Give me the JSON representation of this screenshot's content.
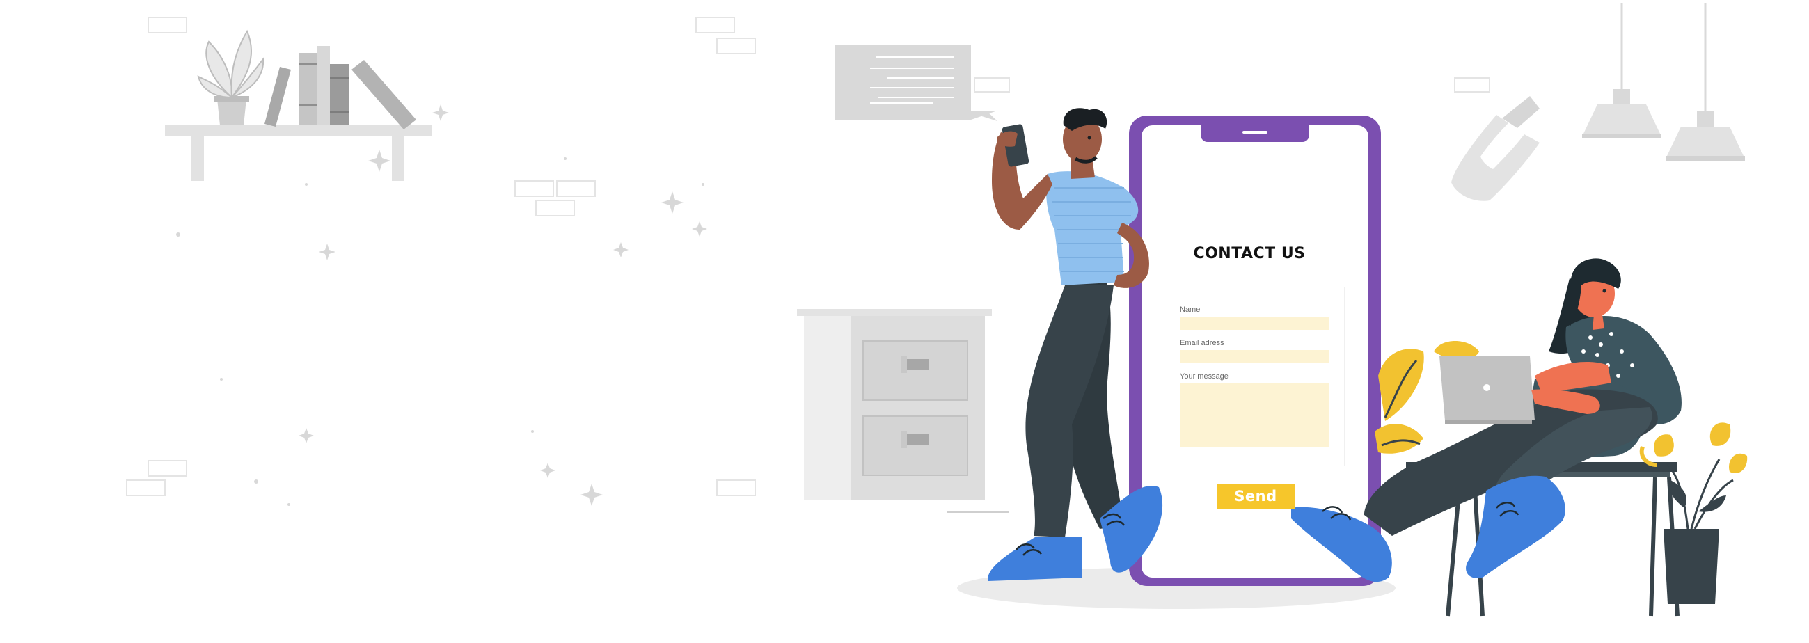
{
  "contact": {
    "title": "CONTACT US",
    "fields": {
      "name_label": "Name",
      "email_label": "Email adress",
      "message_label": "Your message"
    },
    "send_label": "Send"
  },
  "colors": {
    "phone_frame": "#7b4fb0",
    "send_button": "#f6c62b",
    "field_fill": "#fdf3d3",
    "shoe_blue": "#3f7fdc",
    "shirt_blue": "#8fc0ee",
    "pants_dark": "#37434a",
    "skin": "#9c5b45",
    "sweater_teal": "#3d5660",
    "accent_yellow": "#f2c230",
    "decor_gray": "#d9d9d9"
  },
  "icons": [
    "phone-receiver-icon",
    "sparkle-icon",
    "speech-bubble-icon",
    "pendant-lamp-icon"
  ]
}
